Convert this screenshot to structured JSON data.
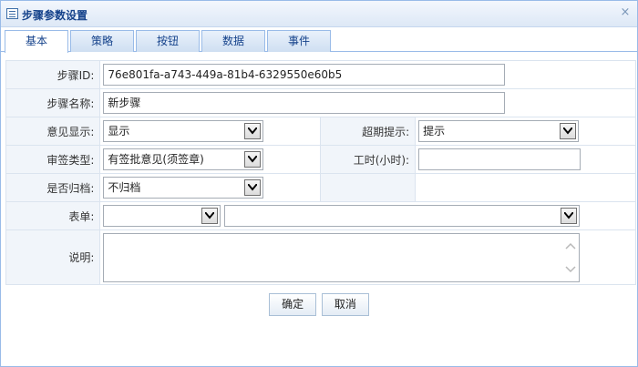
{
  "window": {
    "title": "步骤参数设置",
    "close_glyph": "×"
  },
  "tabs": [
    {
      "label": "基本",
      "active": true
    },
    {
      "label": "策略",
      "active": false
    },
    {
      "label": "按钮",
      "active": false
    },
    {
      "label": "数据",
      "active": false
    },
    {
      "label": "事件",
      "active": false
    }
  ],
  "form": {
    "step_id": {
      "label": "步骤ID:",
      "value": "76e801fa-a743-449a-81b4-6329550e60b5"
    },
    "step_name": {
      "label": "步骤名称:",
      "value": "新步骤"
    },
    "opinion_display": {
      "label": "意见显示:",
      "value": "显示"
    },
    "overdue_reminder": {
      "label": "超期提示:",
      "value": "提示"
    },
    "approval_type": {
      "label": "审签类型:",
      "value": "有签批意见(须签章)"
    },
    "work_hours": {
      "label": "工时(小时):",
      "value": ""
    },
    "archive": {
      "label": "是否归档:",
      "value": "不归档"
    },
    "form_select": {
      "label": "表单:",
      "value_primary": "",
      "value_secondary": ""
    },
    "description": {
      "label": "说明:",
      "value": ""
    }
  },
  "buttons": {
    "confirm": "确定",
    "cancel": "取消"
  },
  "colors": {
    "title_text": "#15428b",
    "border": "#99bbe8",
    "label_bg": "#f1f5fa"
  }
}
